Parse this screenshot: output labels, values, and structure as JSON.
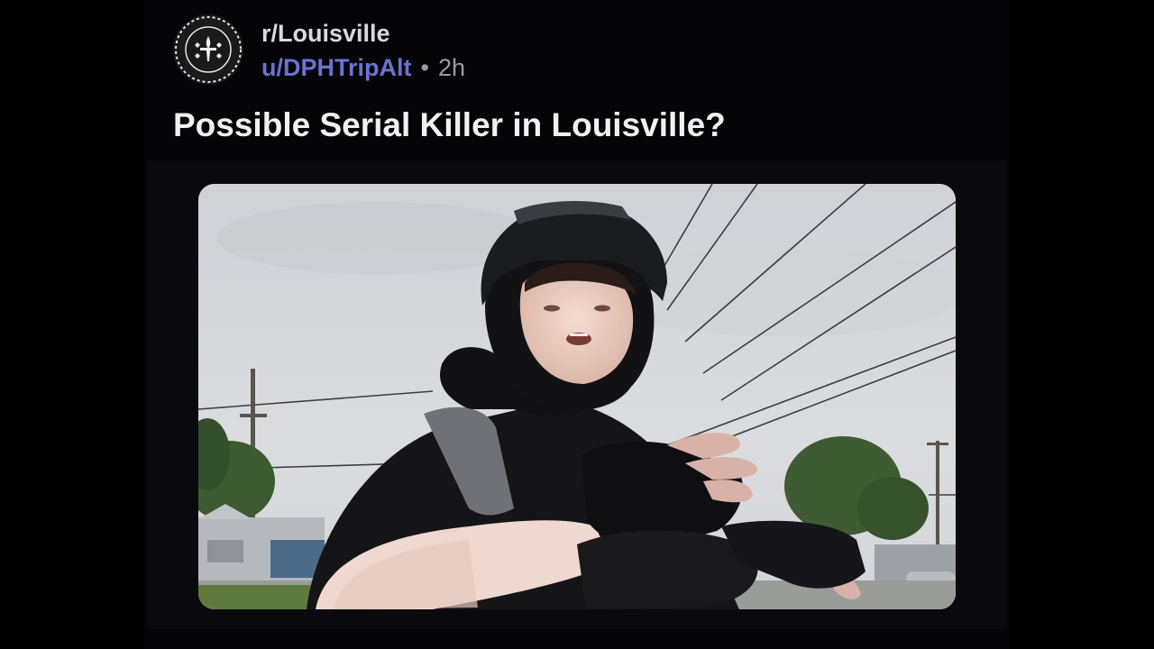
{
  "post": {
    "community": "r/Louisville",
    "author": "u/DPHTripAlt",
    "separator": "•",
    "time": "2h",
    "title": "Possible Serial Killer in Louisville?"
  },
  "media": {
    "type": "photo",
    "subject": "person in black helmet and balaclava gesturing with gloved hands beside power lines"
  },
  "icons": {
    "community_avatar": "fleur-de-lis-badge-icon"
  },
  "colors": {
    "background": "#000000",
    "card": "#050507",
    "username": "#6a73d2",
    "title": "#f0f0f0",
    "meta": "#9a9ca0"
  }
}
